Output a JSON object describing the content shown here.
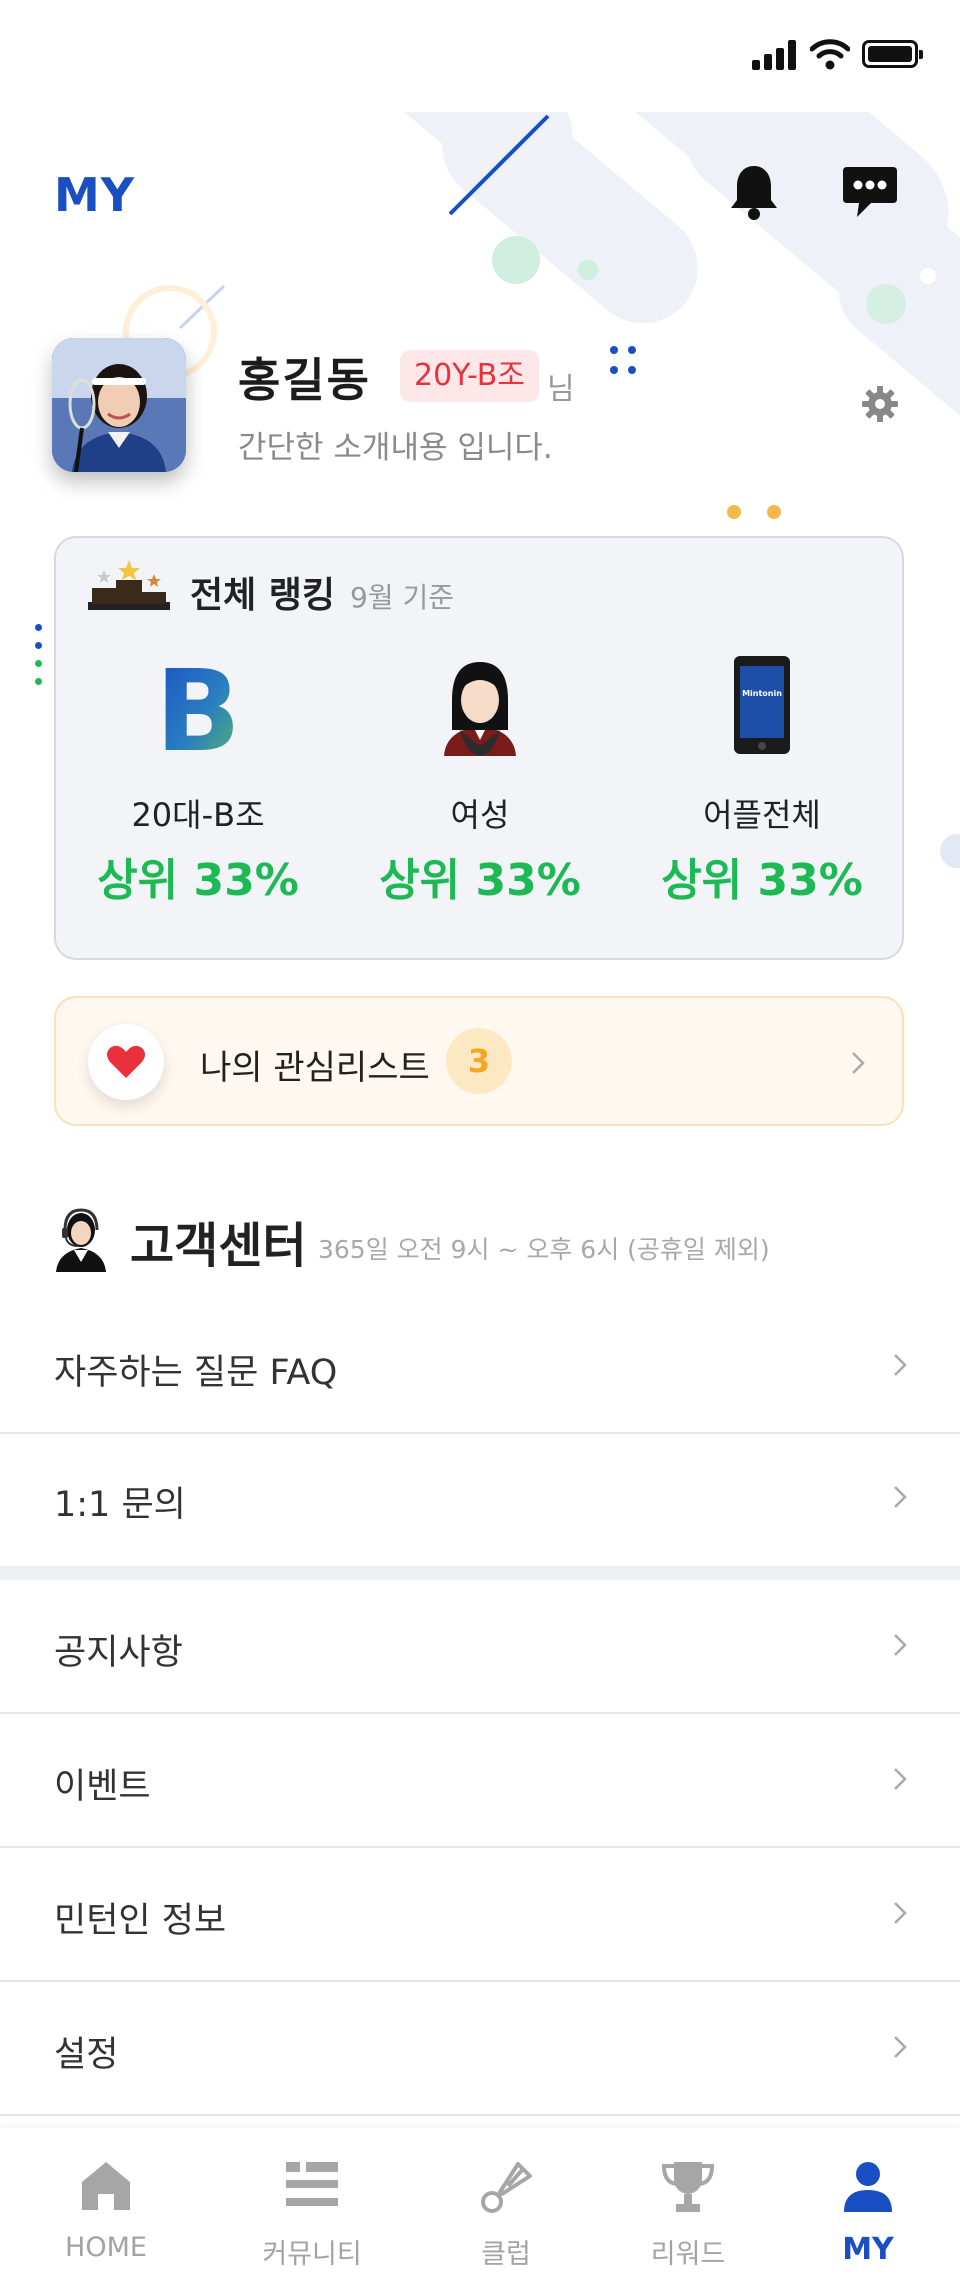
{
  "header": {
    "title": "MY"
  },
  "profile": {
    "name": "홍길동",
    "grade": "20Y-B조",
    "honorific": "님",
    "intro": "간단한 소개내용 입니다."
  },
  "ranking": {
    "title": "전체 랭킹",
    "subtitle": "9월 기준",
    "items": [
      {
        "label": "20대-B조",
        "value": "상위 33%"
      },
      {
        "label": "여성",
        "value": "상위 33%"
      },
      {
        "label": "어플전체",
        "value": "상위 33%"
      }
    ],
    "phone_text": "Mintonin"
  },
  "watchlist": {
    "label": "나의 관심리스트",
    "count": "3"
  },
  "customer_center": {
    "title": "고객센터",
    "hours": "365일 오전 9시 ~ 오후 6시 (공휴일 제외)"
  },
  "menu": {
    "faq": "자주하는 질문 FAQ",
    "inquiry": "1:1 문의",
    "notice": "공지사항",
    "event": "이벤트",
    "info": "민턴인 정보",
    "settings": "설정"
  },
  "tabs": {
    "home": "HOME",
    "community": "커뮤니티",
    "club": "클럽",
    "reward": "리워드",
    "my": "MY"
  },
  "colors": {
    "brand": "#1a4fc4",
    "positive": "#1db954",
    "badge_text": "#e8313d",
    "count": "#f5a623"
  }
}
